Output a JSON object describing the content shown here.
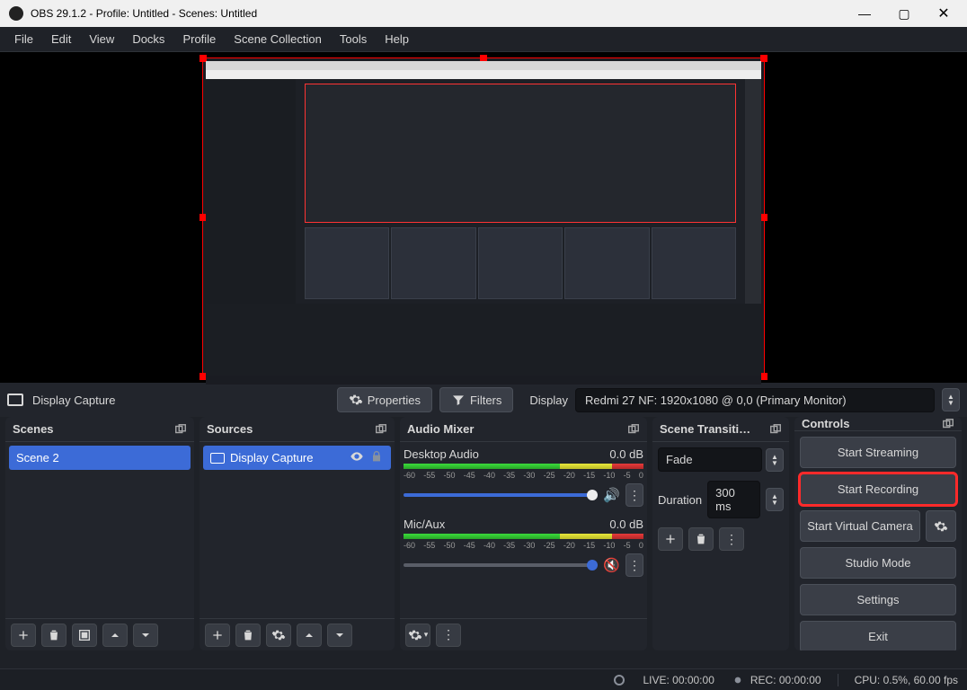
{
  "window": {
    "title": "OBS 29.1.2 - Profile: Untitled - Scenes: Untitled"
  },
  "menu": [
    "File",
    "Edit",
    "View",
    "Docks",
    "Profile",
    "Scene Collection",
    "Tools",
    "Help"
  ],
  "context": {
    "source_name": "Display Capture",
    "properties_btn": "Properties",
    "filters_btn": "Filters",
    "display_label": "Display",
    "display_value": "Redmi 27 NF: 1920x1080 @ 0,0 (Primary Monitor)"
  },
  "docks": {
    "scenes": {
      "title": "Scenes",
      "items": [
        "Scene 2"
      ]
    },
    "sources": {
      "title": "Sources",
      "items": [
        {
          "name": "Display Capture"
        }
      ]
    },
    "mixer": {
      "title": "Audio Mixer",
      "channels": [
        {
          "name": "Desktop Audio",
          "db": "0.0 dB",
          "muted": false
        },
        {
          "name": "Mic/Aux",
          "db": "0.0 dB",
          "muted": true
        }
      ],
      "ticks": [
        "-60",
        "-55",
        "-50",
        "-45",
        "-40",
        "-35",
        "-30",
        "-25",
        "-20",
        "-15",
        "-10",
        "-5",
        "0"
      ]
    },
    "transitions": {
      "title": "Scene Transiti…",
      "selected": "Fade",
      "duration_label": "Duration",
      "duration_value": "300 ms"
    },
    "controls": {
      "title": "Controls",
      "buttons": {
        "stream": "Start Streaming",
        "record": "Start Recording",
        "virtual": "Start Virtual Camera",
        "studio": "Studio Mode",
        "settings": "Settings",
        "exit": "Exit"
      }
    }
  },
  "status": {
    "live": "LIVE: 00:00:00",
    "rec": "REC: 00:00:00",
    "cpu": "CPU: 0.5%, 60.00 fps"
  }
}
